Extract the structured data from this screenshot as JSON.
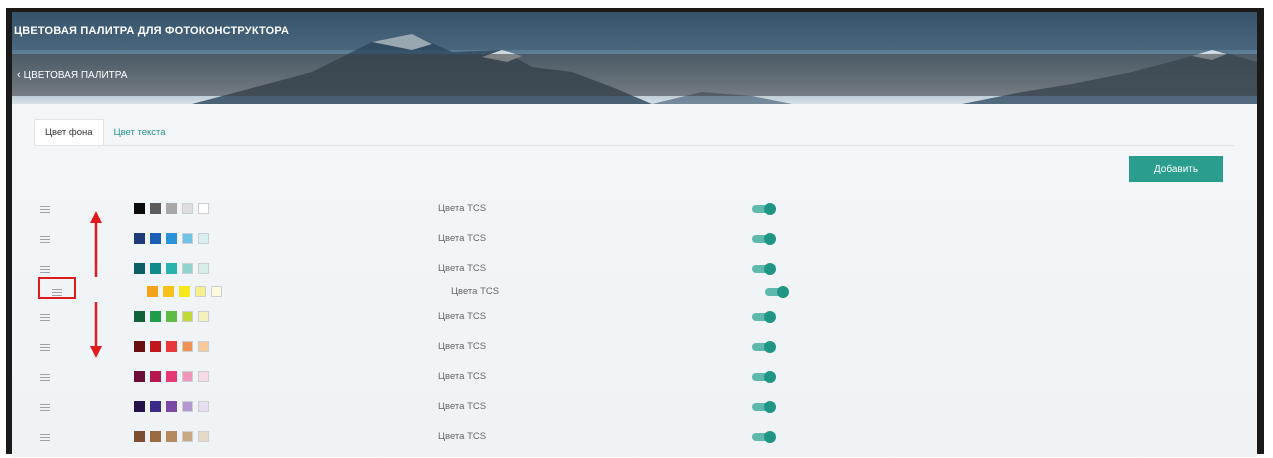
{
  "header": {
    "app_title": "ЦВЕТОВАЯ ПАЛИТРА ДЛЯ ФОТОКОНСТРУКТОРА",
    "back_label": "ЦВЕТОВАЯ ПАЛИТРА",
    "back_icon": "chevron-left-icon"
  },
  "tabs": [
    {
      "label": "Цвет фона",
      "active": true
    },
    {
      "label": "Цвет текста",
      "active": false
    }
  ],
  "toolbar": {
    "add_label": "Добавить"
  },
  "colors": {
    "accent": "#2a9d8f",
    "toggle_on": "#1f9586",
    "annotation": "#e01b1b"
  },
  "palettes": [
    {
      "label": "Цвета TCS",
      "enabled": true,
      "swatches": [
        "#0b0b0b",
        "#5c5c5c",
        "#a8a8a8",
        "#dedede",
        "#ffffff"
      ]
    },
    {
      "label": "Цвета TCS",
      "enabled": true,
      "swatches": [
        "#1e3a78",
        "#1b5fb5",
        "#2a92d9",
        "#6fc3e6",
        "#d8eef1"
      ]
    },
    {
      "label": "Цвета TCS",
      "enabled": true,
      "swatches": [
        "#0d5e63",
        "#12898b",
        "#2ab3ad",
        "#8fd3cf",
        "#d7eeea"
      ]
    },
    {
      "label": "Цвета TCS",
      "enabled": true,
      "dragging": true,
      "swatches": [
        "#f4a21a",
        "#f6c21a",
        "#f7e81e",
        "#f5ef8c",
        "#fdfadf"
      ]
    },
    {
      "label": "Цвета TCS",
      "enabled": true,
      "swatches": [
        "#11613a",
        "#1f9c47",
        "#60bb46",
        "#bfd834",
        "#f3f2bb"
      ]
    },
    {
      "label": "Цвета TCS",
      "enabled": true,
      "swatches": [
        "#6b0e12",
        "#c0161c",
        "#e8393a",
        "#f19252",
        "#f8c89a"
      ]
    },
    {
      "label": "Цвета TCS",
      "enabled": true,
      "swatches": [
        "#6a0f37",
        "#b5174e",
        "#e53877",
        "#f096bd",
        "#f8d9e6"
      ]
    },
    {
      "label": "Цвета TCS",
      "enabled": true,
      "swatches": [
        "#25134a",
        "#3d2a86",
        "#7c48a6",
        "#b497cf",
        "#e4def0"
      ]
    },
    {
      "label": "Цвета TCS",
      "enabled": true,
      "swatches": [
        "#7a4e2e",
        "#9a6b3f",
        "#b68a5c",
        "#c9a882",
        "#e6d9c6"
      ]
    }
  ]
}
